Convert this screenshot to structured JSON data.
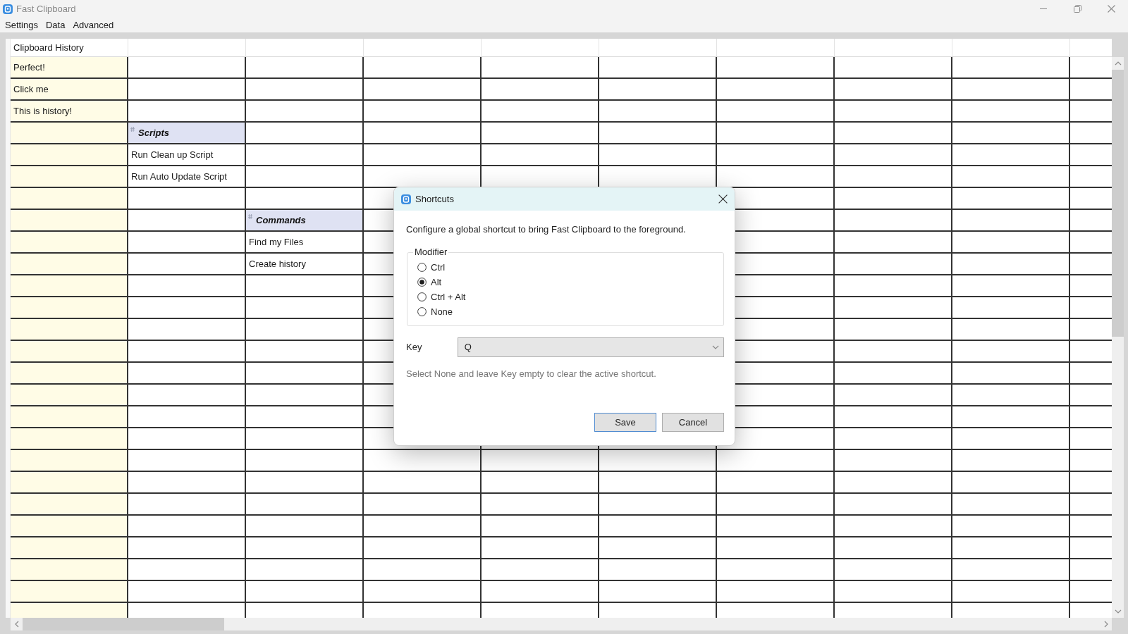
{
  "window": {
    "title": "Fast Clipboard"
  },
  "menu": [
    "Settings",
    "Data",
    "Advanced"
  ],
  "table": {
    "columns": [
      {
        "heading": "Clipboard History",
        "kind": "history"
      }
    ],
    "rows": [
      {
        "column_1": {
          "text": "Perfect!",
          "kind": "entry"
        }
      },
      {
        "column_1": {
          "text": "Click me",
          "kind": "entry"
        }
      },
      {
        "column_1": {
          "text": "This is history!",
          "kind": "entry"
        }
      },
      {
        "column_2": {
          "text": "Scripts",
          "kind": "group"
        }
      },
      {
        "column_2": {
          "text": "Run Clean up Script",
          "kind": "entry"
        }
      },
      {
        "column_2": {
          "text": "Run Auto Update Script",
          "kind": "entry"
        }
      },
      {},
      {
        "column_3": {
          "text": "Commands",
          "kind": "group"
        }
      },
      {
        "column_3": {
          "text": "Find my Files",
          "kind": "entry"
        }
      },
      {
        "column_3": {
          "text": "Create history",
          "kind": "entry"
        }
      }
    ]
  },
  "dialog": {
    "title": "Shortcuts",
    "description": "Configure a global shortcut to bring Fast Clipboard to the foreground.",
    "modifier": {
      "legend": "Modifier",
      "options": [
        {
          "label": "Ctrl",
          "selected": false
        },
        {
          "label": "Alt",
          "selected": true
        },
        {
          "label": "Ctrl + Alt",
          "selected": false
        },
        {
          "label": "None",
          "selected": false
        }
      ]
    },
    "key": {
      "label": "Key",
      "value": "Q"
    },
    "hint": "Select None and leave Key empty to clear the active shortcut.",
    "buttons": [
      {
        "label": "Save",
        "kind": "default"
      },
      {
        "label": "Cancel",
        "kind": "normal"
      }
    ]
  }
}
